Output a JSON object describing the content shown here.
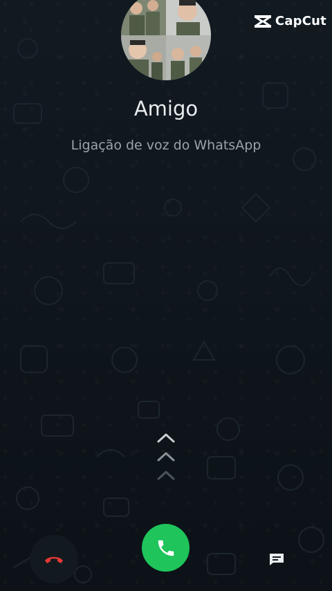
{
  "watermark": {
    "text": "CapCut",
    "icon": "capcut-logo-icon"
  },
  "caller": {
    "name": "Amigo",
    "subtitle": "Ligação de voz do WhatsApp",
    "avatar_icon": "contact-photo-collage"
  },
  "actions": {
    "swipe_hint_icon": "chevron-up-icon",
    "decline_icon": "phone-hangup-icon",
    "answer_icon": "phone-icon",
    "message_icon": "message-icon"
  },
  "colors": {
    "background": "#0e141a",
    "answer": "#1fc45b",
    "decline": "#e53935",
    "name_text": "#e9edef",
    "subtitle_text": "#9aa4ab"
  }
}
